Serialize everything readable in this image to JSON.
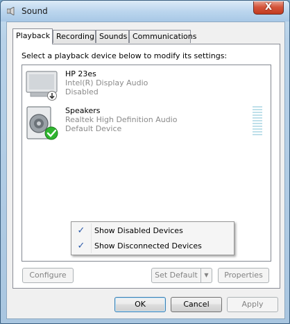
{
  "window": {
    "title": "Sound",
    "close_label": "X"
  },
  "tabs": [
    {
      "label": "Playback",
      "active": true
    },
    {
      "label": "Recording",
      "active": false
    },
    {
      "label": "Sounds",
      "active": false
    },
    {
      "label": "Communications",
      "active": false
    }
  ],
  "panel": {
    "prompt": "Select a playback device below to modify its settings:"
  },
  "devices": [
    {
      "name": "HP 23es",
      "driver": "Intel(R) Display Audio",
      "status": "Disabled",
      "icon": "monitor-icon"
    },
    {
      "name": "Speakers",
      "driver": "Realtek High Definition Audio",
      "status": "Default Device",
      "icon": "speaker-icon"
    }
  ],
  "context_menu": {
    "items": [
      {
        "label": "Show Disabled Devices",
        "checked": true
      },
      {
        "label": "Show Disconnected Devices",
        "checked": true
      }
    ],
    "check_glyph": "✓"
  },
  "panel_buttons": {
    "configure": "Configure",
    "set_default": "Set Default",
    "properties": "Properties"
  },
  "dialog_buttons": {
    "ok": "OK",
    "cancel": "Cancel",
    "apply": "Apply"
  },
  "colors": {
    "accent_check": "#2a58a8",
    "default_badge": "#2fb52f"
  }
}
